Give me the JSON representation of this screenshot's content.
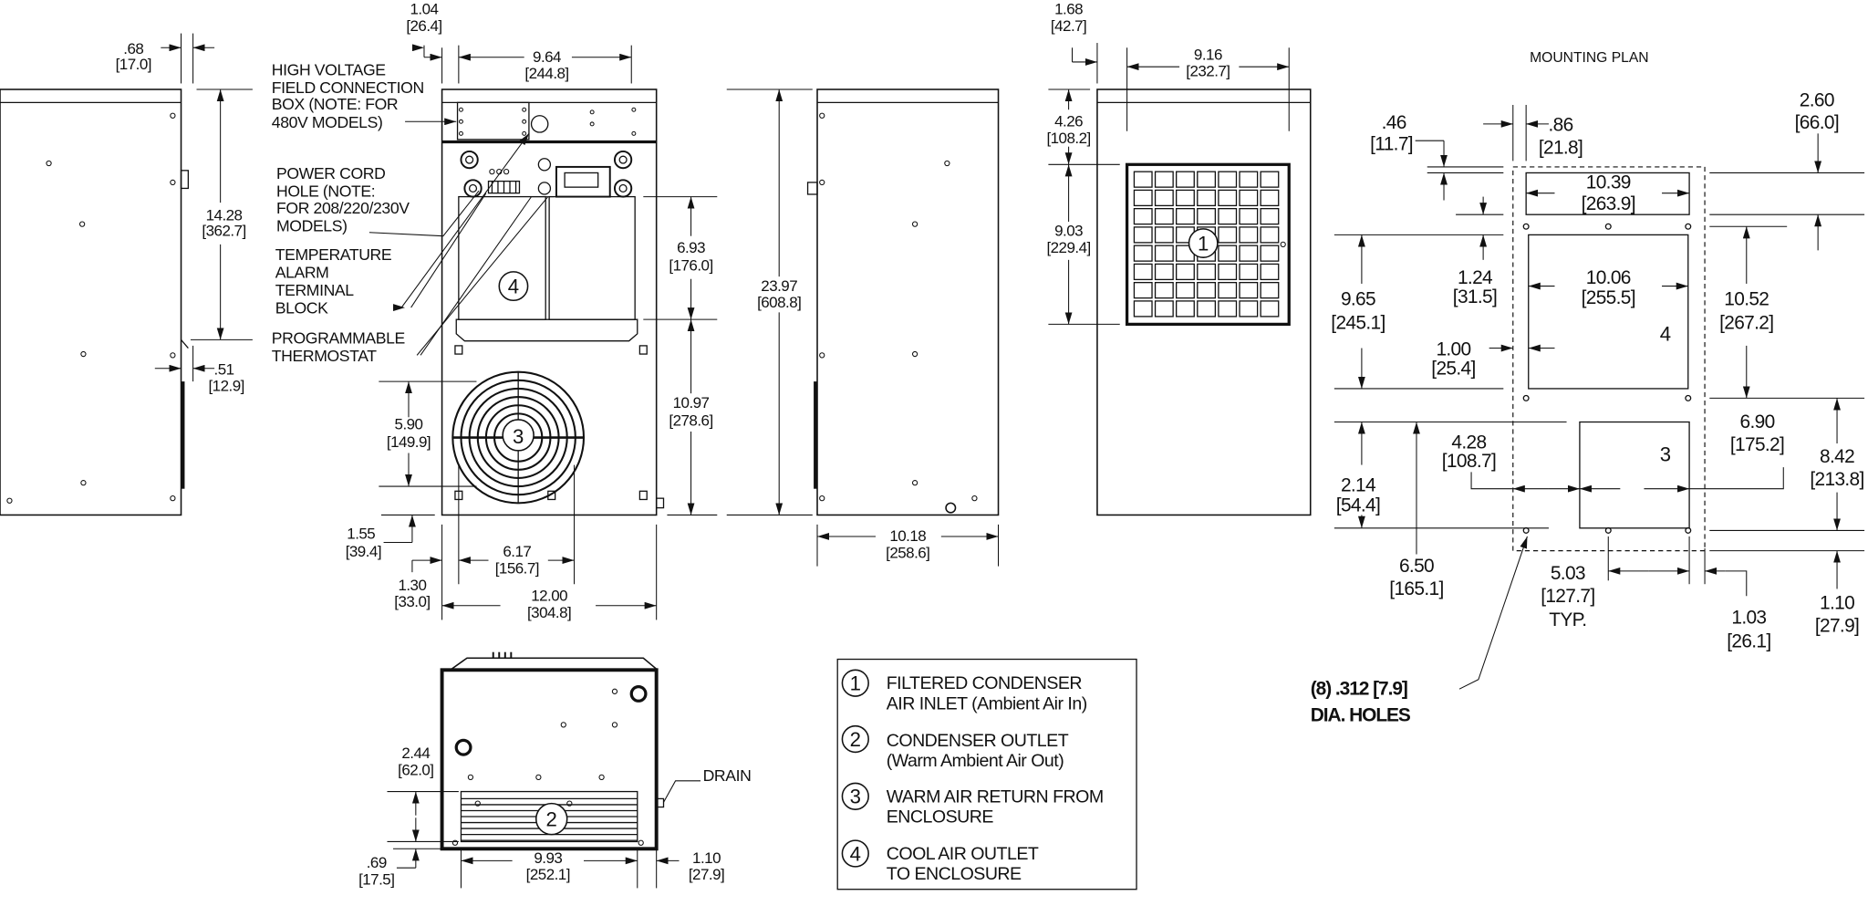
{
  "labels": {
    "high_voltage": [
      "HIGH VOLTAGE",
      "FIELD CONNECTION",
      "BOX (NOTE: FOR",
      "480V MODELS)"
    ],
    "power_cord": [
      "POWER CORD",
      "HOLE (NOTE:",
      "FOR 208/220/230V",
      "MODELS)"
    ],
    "temp_alarm": [
      "TEMPERATURE",
      "ALARM",
      "TERMINAL",
      "BLOCK"
    ],
    "thermostat": [
      "PROGRAMMABLE",
      "THERMOSTAT"
    ],
    "drain": "DRAIN",
    "mounting_title": "MOUNTING PLAN",
    "holes": [
      "(8) .312 [7.9]",
      "DIA. HOLES"
    ],
    "typ": "TYP."
  },
  "callouts": {
    "one": "1",
    "two": "2",
    "three": "3",
    "four": "4"
  },
  "dims": {
    "d068": [
      ".68",
      "[17.0]"
    ],
    "d1428": [
      "14.28",
      "[362.7]"
    ],
    "d051": [
      ".51",
      "[12.9]"
    ],
    "d104": [
      "1.04",
      "[26.4]"
    ],
    "d964": [
      "9.64",
      "[244.8]"
    ],
    "d693": [
      "6.93",
      "[176.0]"
    ],
    "d1097": [
      "10.97",
      "[278.6]"
    ],
    "d590": [
      "5.90",
      "[149.9]"
    ],
    "d155": [
      "1.55",
      "[39.4]"
    ],
    "d130": [
      "1.30",
      "[33.0]"
    ],
    "d617": [
      "6.17",
      "[156.7]"
    ],
    "d1200": [
      "12.00",
      "[304.8]"
    ],
    "d2397": [
      "23.97",
      "[608.8]"
    ],
    "d1018": [
      "10.18",
      "[258.6]"
    ],
    "d168": [
      "1.68",
      "[42.7]"
    ],
    "d916": [
      "9.16",
      "[232.7]"
    ],
    "d426": [
      "4.26",
      "[108.2]"
    ],
    "d903": [
      "9.03",
      "[229.4]"
    ],
    "d244": [
      "2.44",
      "[62.0]"
    ],
    "d069": [
      ".69",
      "[17.5]"
    ],
    "d993": [
      "9.93",
      "[252.1]"
    ],
    "d110b": [
      "1.10",
      "[27.9]"
    ],
    "m046": [
      ".46",
      "[11.7]"
    ],
    "m086": [
      ".86",
      "[21.8]"
    ],
    "m260": [
      "2.60",
      "[66.0]"
    ],
    "m1039": [
      "10.39",
      "[263.9]"
    ],
    "m124": [
      "1.24",
      "[31.5]"
    ],
    "m1006": [
      "10.06",
      "[255.5]"
    ],
    "m965": [
      "9.65",
      "[245.1]"
    ],
    "m1052": [
      "10.52",
      "[267.2]"
    ],
    "m100": [
      "1.00",
      "[25.4]"
    ],
    "m690": [
      "6.90",
      "[175.2]"
    ],
    "m428": [
      "4.28",
      "[108.7]"
    ],
    "m842": [
      "8.42",
      "[213.8]"
    ],
    "m214": [
      "2.14",
      "[54.4]"
    ],
    "m650": [
      "6.50",
      "[165.1]"
    ],
    "m503": [
      "5.03",
      "[127.7]"
    ],
    "m103": [
      "1.03",
      "[26.1]"
    ],
    "m110": [
      "1.10",
      "[27.9]"
    ]
  },
  "legend": {
    "items": [
      {
        "num": "1",
        "lines": [
          "FILTERED CONDENSER",
          "AIR INLET (Ambient Air In)"
        ]
      },
      {
        "num": "2",
        "lines": [
          "CONDENSER OUTLET",
          "(Warm Ambient Air Out)"
        ]
      },
      {
        "num": "3",
        "lines": [
          "WARM AIR RETURN FROM",
          "ENCLOSURE"
        ]
      },
      {
        "num": "4",
        "lines": [
          "COOL AIR OUTLET",
          "TO ENCLOSURE"
        ]
      }
    ]
  },
  "colors": {
    "line": "#111111",
    "background": "#ffffff"
  }
}
